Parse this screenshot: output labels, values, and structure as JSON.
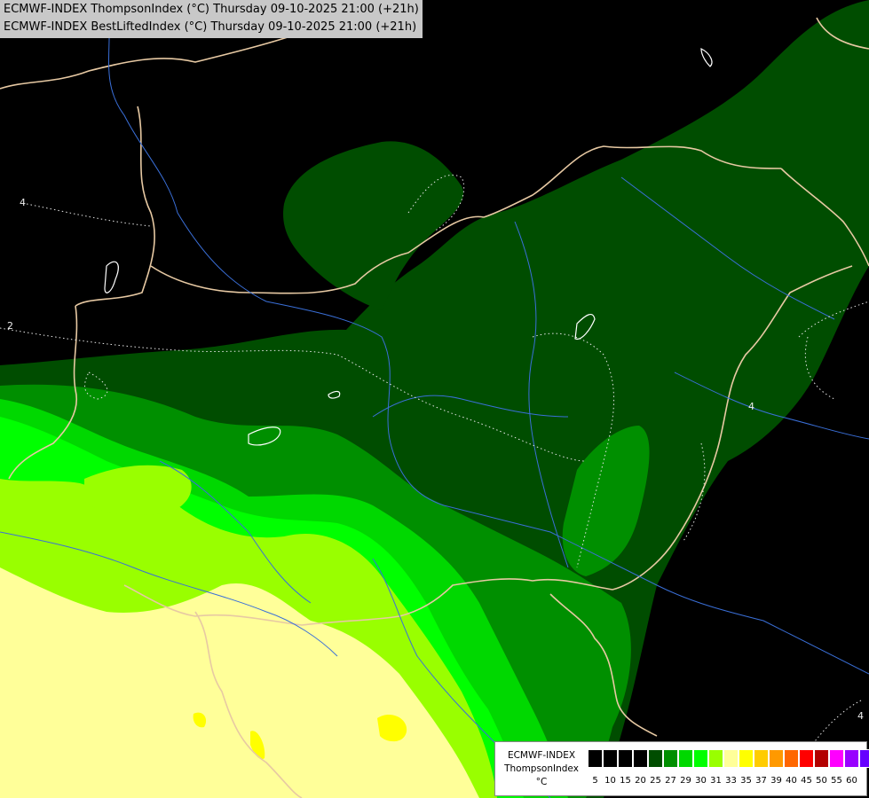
{
  "header": {
    "line1": "ECMWF-INDEX ThompsonIndex (°C) Thursday 09-10-2025 21:00 (+21h)",
    "line2": "ECMWF-INDEX BestLiftedIndex (°C) Thursday 09-10-2025 21:00 (+21h)"
  },
  "map": {
    "contour_labels": [
      {
        "text": "4"
      },
      {
        "text": "2"
      },
      {
        "text": "4"
      },
      {
        "text": "4"
      }
    ]
  },
  "legend": {
    "title_line1": "ECMWF-INDEX",
    "title_line2": "ThompsonIndex",
    "title_line3": "°C",
    "classes": [
      {
        "label": "5",
        "color": "#000000"
      },
      {
        "label": "10",
        "color": "#000000"
      },
      {
        "label": "15",
        "color": "#000000"
      },
      {
        "label": "20",
        "color": "#000000"
      },
      {
        "label": "25",
        "color": "#004d00"
      },
      {
        "label": "27",
        "color": "#008f00"
      },
      {
        "label": "29",
        "color": "#00d800"
      },
      {
        "label": "30",
        "color": "#00ff00"
      },
      {
        "label": "31",
        "color": "#99ff00"
      },
      {
        "label": "33",
        "color": "#ffff99"
      },
      {
        "label": "35",
        "color": "#ffff00"
      },
      {
        "label": "37",
        "color": "#ffcc00"
      },
      {
        "label": "39",
        "color": "#ff9900"
      },
      {
        "label": "40",
        "color": "#ff6600"
      },
      {
        "label": "45",
        "color": "#ff0000"
      },
      {
        "label": "50",
        "color": "#b30000"
      },
      {
        "label": "55",
        "color": "#ff00ff"
      },
      {
        "label": "60",
        "color": "#9900ff"
      },
      {
        "label": "",
        "color": "#6600ff"
      },
      {
        "label": "",
        "color": "#0000ff"
      }
    ]
  }
}
